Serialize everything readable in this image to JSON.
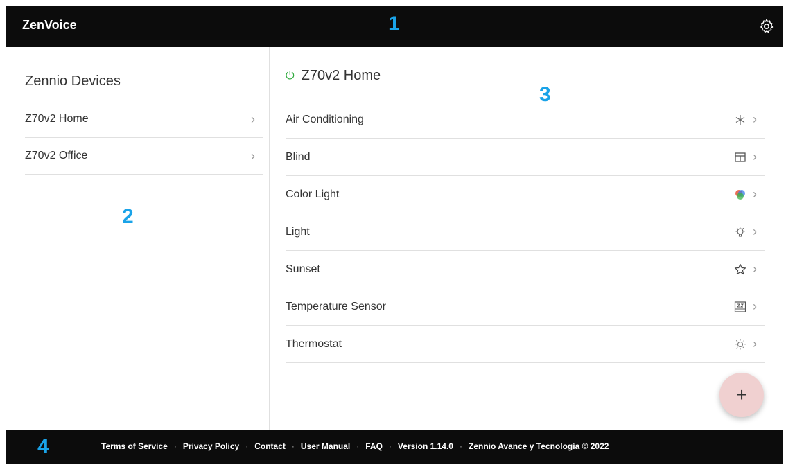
{
  "header": {
    "brand": "ZenVoice",
    "settings_icon": "gear-icon"
  },
  "callouts": [
    "1",
    "2",
    "3",
    "4"
  ],
  "devices": {
    "title": "Zennio Devices",
    "items": [
      {
        "label": "Z70v2 Home"
      },
      {
        "label": "Z70v2 Office"
      }
    ]
  },
  "detail": {
    "title": "Z70v2 Home",
    "power_color": "#2eaa3c",
    "items": [
      {
        "label": "Air Conditioning",
        "icon": "snowflake-icon"
      },
      {
        "label": "Blind",
        "icon": "blind-icon"
      },
      {
        "label": "Color Light",
        "icon": "color-light-icon"
      },
      {
        "label": "Light",
        "icon": "bulb-icon"
      },
      {
        "label": "Sunset",
        "icon": "star-icon"
      },
      {
        "label": "Temperature Sensor",
        "icon": "temperature-sensor-icon"
      },
      {
        "label": "Thermostat",
        "icon": "sun-icon"
      }
    ],
    "fab_label": "+"
  },
  "footer": {
    "terms": "Terms of Service",
    "privacy": "Privacy Policy",
    "contact": "Contact",
    "manual": "User Manual",
    "faq": "FAQ",
    "version": "Version 1.14.0",
    "copyright": "Zennio Avance y Tecnología © 2022",
    "separator": "·"
  }
}
